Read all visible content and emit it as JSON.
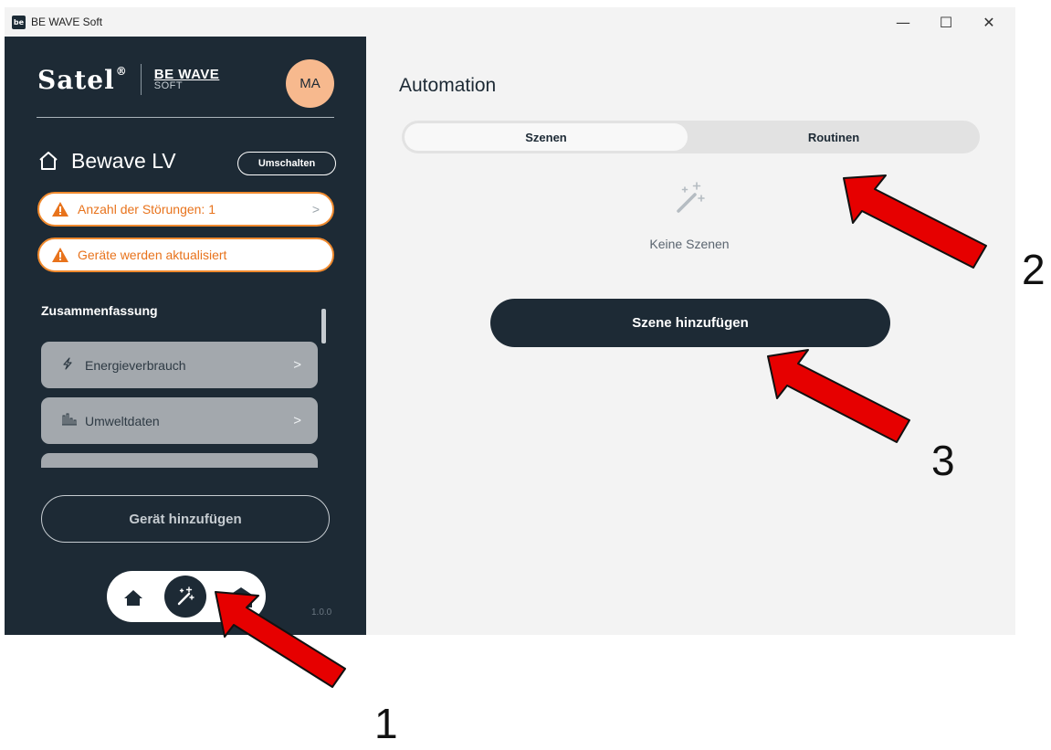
{
  "titlebar": {
    "app_icon_text": "be",
    "title": "BE WAVE Soft",
    "minimize": "—",
    "maximize": "☐",
    "close": "✕"
  },
  "sidebar": {
    "brand": {
      "satel": "Satel",
      "bewave_line1": "BE WAVE",
      "bewave_line2": "SOFT"
    },
    "avatar": "MA",
    "home_name": "Bewave LV",
    "switch_label": "Umschalten",
    "alerts": [
      {
        "label": "Anzahl der Störungen: 1",
        "has_chevron": true
      },
      {
        "label": "Geräte werden aktualisiert",
        "has_chevron": false
      }
    ],
    "summary_title": "Zusammenfassung",
    "summary_items": [
      {
        "label": "Energieverbrauch",
        "icon": "lightning-icon"
      },
      {
        "label": "Umweltdaten",
        "icon": "bar-chart-icon"
      }
    ],
    "add_device": "Gerät hinzufügen",
    "nav": {
      "home": "home-icon",
      "automation": "magic-wand-icon",
      "third": "building-icon",
      "active": "automation"
    },
    "version": "1.0.0"
  },
  "main": {
    "title": "Automation",
    "tabs": [
      {
        "label": "Szenen",
        "active": true
      },
      {
        "label": "Routinen",
        "active": false
      }
    ],
    "empty_text": "Keine Szenen",
    "add_scene": "Szene hinzufügen"
  },
  "annotations": {
    "arrow_color": "#ff0000",
    "labels": [
      "1",
      "2",
      "3"
    ]
  },
  "colors": {
    "sidebar_bg": "#1d2a35",
    "accent_orange": "#f08a2e",
    "avatar_bg": "#f7b98e",
    "main_bg": "#f3f3f3"
  }
}
